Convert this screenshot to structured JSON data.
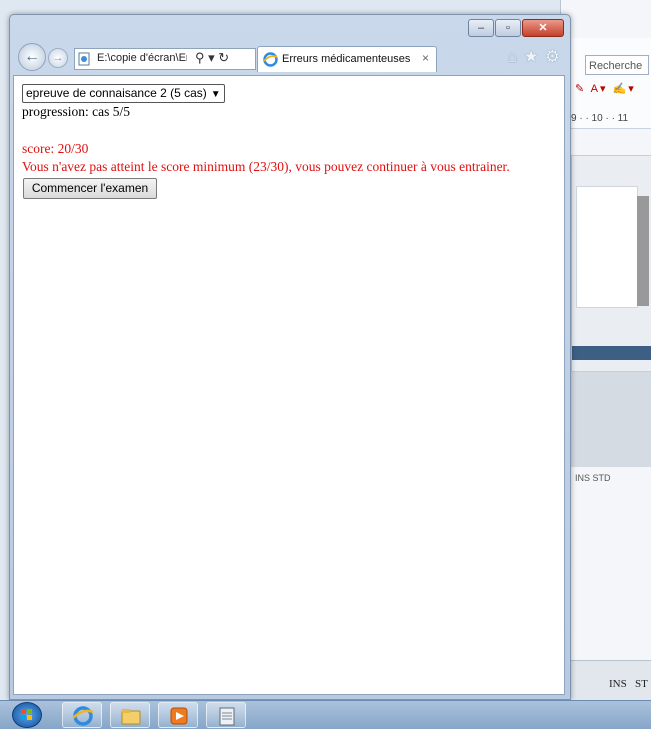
{
  "browser": {
    "address_url": "E:\\copie d'écran\\Erre",
    "tab_title": "Erreurs médicamenteuses",
    "tab_close": "×",
    "addr_tools": "⚲ ▾ ↻",
    "window_controls": {
      "minimize": "–",
      "maximize": "▫",
      "close": "✕"
    }
  },
  "page": {
    "select_value": "epreuve de connaisance 2 (5 cas)",
    "progression": "progression: cas 5/5",
    "score": "score: 20/30",
    "message": "Vous n'avez pas atteint le score minimum (23/30), vous pouvez continuer à vous entrainer.",
    "start_button": "Commencer l'examen"
  },
  "background_app": {
    "search_placeholder": "Recherche",
    "ruler": "9 · · 10 · · 11",
    "status_segments": [
      "INS",
      "ST"
    ],
    "mini_status": "INS STD"
  },
  "colors": {
    "error_text": "#e01010",
    "taskbar": "#9db6d3"
  },
  "icons": [
    "back-arrow-icon",
    "forward-arrow-icon",
    "ie-icon",
    "home-icon",
    "star-icon",
    "gear-icon",
    "windows-start-icon",
    "folder-icon",
    "media-player-icon",
    "notepad-icon"
  ]
}
